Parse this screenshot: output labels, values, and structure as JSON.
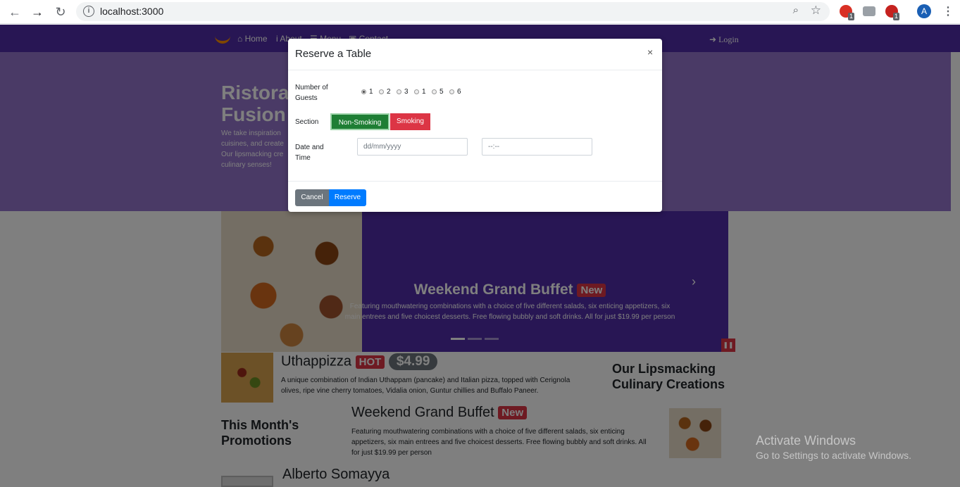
{
  "browser": {
    "url": "localhost:3000",
    "ext_badge_1": "1",
    "ext_badge_2": "1",
    "avatar": "A"
  },
  "navbar": {
    "home": "Home",
    "about": "About",
    "menu": "Menu",
    "contact": "Contact",
    "login": "Login"
  },
  "jumbotron": {
    "title_line1": "Ristorante Con",
    "title_line2": "Fusion",
    "text_line1": "We take inspiration",
    "text_line2": "cuisines, and create",
    "text_line3": "Our lipsmacking cre",
    "text_line4": "culinary senses!"
  },
  "carousel": {
    "title": "Weekend Grand Buffet",
    "badge": "New",
    "desc_line1": "Featuring mouthwatering combinations with a choice of five different salads, six enticing appetizers, six",
    "desc_line2": "main entrees and five choicest desserts. Free flowing bubbly and soft drinks. All for just $19.99 per person"
  },
  "dish": {
    "name": "Uthappizza",
    "badge": "HOT",
    "price": "$4.99",
    "desc_line1": "A unique combination of Indian Uthappam (pancake) and Italian pizza, topped with Cerignola",
    "desc_line2": "olives, ripe vine cherry tomatoes, Vidalia onion, Guntur chillies and Buffalo Paneer."
  },
  "side_heading_1": {
    "line1": "Our Lipsmacking",
    "line2": "Culinary Creations"
  },
  "side_heading_2": {
    "line1": "This Month's",
    "line2": "Promotions"
  },
  "promotion": {
    "name": "Weekend Grand Buffet",
    "badge": "New",
    "desc_line1": "Featuring mouthwatering combinations with a choice of five different salads, six enticing",
    "desc_line2": "appetizers, six main entrees and five choicest desserts. Free flowing bubbly and soft drinks. All",
    "desc_line3": "for just $19.99 per person"
  },
  "leader": {
    "name": "Alberto Somayya"
  },
  "windows": {
    "line1": "Activate Windows",
    "line2": "Go to Settings to activate Windows."
  },
  "modal": {
    "title": "Reserve a Table",
    "close": "×",
    "guests_label_line1": "Number of",
    "guests_label_line2": "Guests",
    "guest_options": [
      "1",
      "2",
      "3",
      "1",
      "5",
      "6"
    ],
    "section_label": "Section",
    "non_smoking": "Non-Smoking",
    "smoking": "Smoking",
    "datetime_label_line1": "Date and",
    "datetime_label_line2": "Time",
    "date_placeholder": "dd/mm/yyyy",
    "time_placeholder": "--:--",
    "cancel": "Cancel",
    "reserve": "Reserve"
  },
  "colors": {
    "primary": "#512da8",
    "jumbotron": "#9575cd",
    "success": "#28a745",
    "danger": "#dc3545",
    "blue": "#007bff",
    "secondary": "#6c757d"
  }
}
